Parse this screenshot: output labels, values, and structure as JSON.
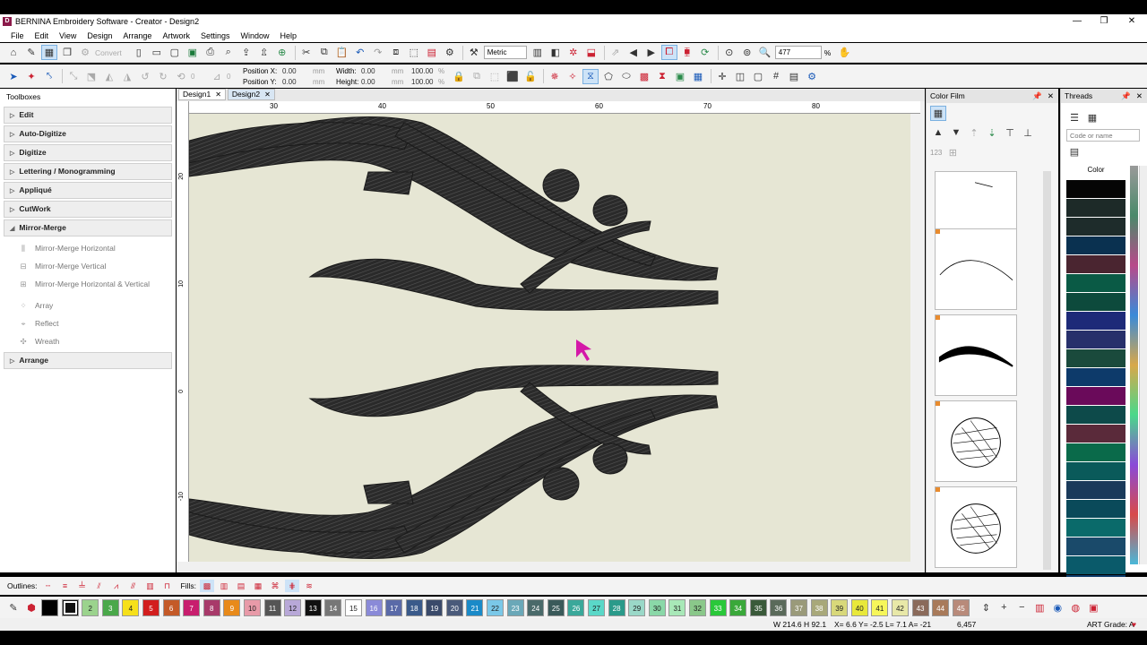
{
  "window": {
    "title": "BERNINA Embroidery Software - Creator - Design2",
    "app_icon": "D"
  },
  "menu": [
    "File",
    "Edit",
    "View",
    "Design",
    "Arrange",
    "Artwork",
    "Settings",
    "Window",
    "Help"
  ],
  "toolbar": {
    "convert_label": "Convert",
    "units": "Metric",
    "zoom": "477",
    "zoom_unit": "%"
  },
  "props": {
    "pos_x_label": "Position X:",
    "pos_y_label": "Position Y:",
    "pos_x": "0.00",
    "pos_y": "0.00",
    "width_label": "Width:",
    "height_label": "Height:",
    "width": "0.00",
    "height": "0.00",
    "unit": "mm",
    "scale_w": "100.00",
    "scale_h": "100.00",
    "pct": "%",
    "rotate": "0"
  },
  "toolboxes": {
    "title": "Toolboxes",
    "groups": [
      "Edit",
      "Auto-Digitize",
      "Digitize",
      "Lettering / Monogramming",
      "Appliqué",
      "CutWork",
      "Mirror-Merge"
    ],
    "mirror_merge_items": [
      "Mirror-Merge Horizontal",
      "Mirror-Merge Vertical",
      "Mirror-Merge Horizontal & Vertical"
    ],
    "extra_items": [
      "Array",
      "Reflect",
      "Wreath"
    ],
    "arrange": "Arrange"
  },
  "doc_tabs": [
    "Design1",
    "Design2"
  ],
  "ruler": {
    "h_ticks": [
      "30",
      "40",
      "50",
      "60",
      "70",
      "80"
    ],
    "v_ticks": [
      "20",
      "10",
      "0",
      "-10"
    ]
  },
  "color_film": {
    "title": "Color Film",
    "seq_label": "123"
  },
  "threads": {
    "title": "Threads",
    "search_placeholder": "Code or name",
    "column": "Color",
    "swatches": [
      "#050505",
      "#1d2a28",
      "#1e2c2b",
      "#0a3150",
      "#4a2530",
      "#0a5a45",
      "#0d4a3c",
      "#1d2a78",
      "#27306b",
      "#1a4a3c",
      "#0d3a6a",
      "#6a0a5a",
      "#0d4a4a",
      "#5a2a3a",
      "#0a6a4a",
      "#0a5a5a",
      "#1a3a5a",
      "#0a4a5a",
      "#0a6a6a",
      "#1a4a6a",
      "#0a5a6a",
      "#0a3a6a"
    ]
  },
  "outlines_label": "Outlines:",
  "fills_label": "Fills:",
  "colorbar": [
    {
      "n": "",
      "c": "#000000"
    },
    {
      "n": "",
      "c": "#111111"
    },
    {
      "n": "2",
      "c": "#9bd38d"
    },
    {
      "n": "3",
      "c": "#4aa84a"
    },
    {
      "n": "4",
      "c": "#f6e01a"
    },
    {
      "n": "5",
      "c": "#d21e1e"
    },
    {
      "n": "6",
      "c": "#c45a28"
    },
    {
      "n": "7",
      "c": "#c81e6e"
    },
    {
      "n": "8",
      "c": "#a83a6a"
    },
    {
      "n": "9",
      "c": "#e88a1a"
    },
    {
      "n": "10",
      "c": "#e89aa8"
    },
    {
      "n": "11",
      "c": "#555555"
    },
    {
      "n": "12",
      "c": "#b8a8d8"
    },
    {
      "n": "13",
      "c": "#111111"
    },
    {
      "n": "14",
      "c": "#777777"
    },
    {
      "n": "15",
      "c": "#ffffff"
    },
    {
      "n": "16",
      "c": "#8a8ad8"
    },
    {
      "n": "17",
      "c": "#5a6aa8"
    },
    {
      "n": "18",
      "c": "#3a5a8a"
    },
    {
      "n": "19",
      "c": "#3a4a6a"
    },
    {
      "n": "20",
      "c": "#4a5a7a"
    },
    {
      "n": "21",
      "c": "#1a8ac8"
    },
    {
      "n": "22",
      "c": "#7ac8e8"
    },
    {
      "n": "23",
      "c": "#6aa8b8"
    },
    {
      "n": "24",
      "c": "#4a6a6a"
    },
    {
      "n": "25",
      "c": "#3a5a5a"
    },
    {
      "n": "26",
      "c": "#3aa89a"
    },
    {
      "n": "27",
      "c": "#5ad8c8"
    },
    {
      "n": "28",
      "c": "#2a9a8a"
    },
    {
      "n": "29",
      "c": "#9ad8c8"
    },
    {
      "n": "30",
      "c": "#8ad8a8"
    },
    {
      "n": "31",
      "c": "#a8e8b8"
    },
    {
      "n": "32",
      "c": "#8ac88a"
    },
    {
      "n": "33",
      "c": "#2ac83a"
    },
    {
      "n": "34",
      "c": "#3aa83a"
    },
    {
      "n": "35",
      "c": "#3a5a3a"
    },
    {
      "n": "36",
      "c": "#5a6a5a"
    },
    {
      "n": "37",
      "c": "#9a9a7a"
    },
    {
      "n": "38",
      "c": "#a8a87a"
    },
    {
      "n": "39",
      "c": "#d8d87a"
    },
    {
      "n": "40",
      "c": "#e8e83a"
    },
    {
      "n": "41",
      "c": "#f6f65a"
    },
    {
      "n": "42",
      "c": "#e8e8a8"
    },
    {
      "n": "43",
      "c": "#8a6a5a"
    },
    {
      "n": "44",
      "c": "#a87a5a"
    },
    {
      "n": "45",
      "c": "#b88a7a"
    }
  ],
  "status": {
    "size": "W 214.6 H  92.1",
    "coords": "X=   6.6 Y=  -2.5 L=   7.1 A= -21",
    "stitches": "6,457",
    "grade": "ART Grade: A"
  }
}
